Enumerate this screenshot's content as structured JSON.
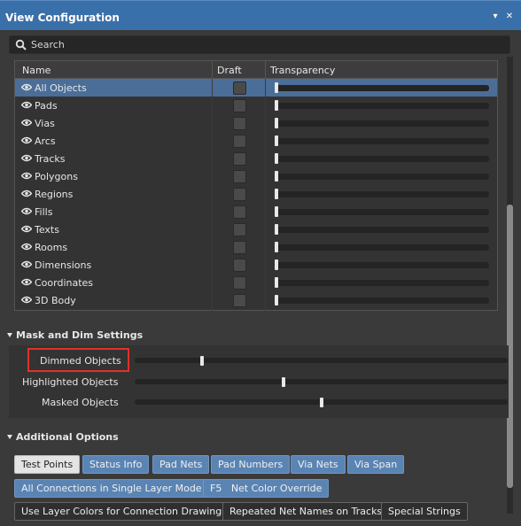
{
  "window": {
    "title": "View Configuration",
    "pin_glyph": "▾",
    "close_glyph": "✕"
  },
  "search": {
    "placeholder": "Search",
    "icon": "search-icon"
  },
  "objects": {
    "columns": {
      "name": "Name",
      "draft": "Draft",
      "transparency": "Transparency"
    },
    "rows": [
      {
        "label": "All Objects",
        "selected": true,
        "draft": false,
        "transparency": 0
      },
      {
        "label": "Pads",
        "draft": false,
        "transparency": 0
      },
      {
        "label": "Vias",
        "draft": false,
        "transparency": 0
      },
      {
        "label": "Arcs",
        "draft": false,
        "transparency": 0
      },
      {
        "label": "Tracks",
        "draft": false,
        "transparency": 0
      },
      {
        "label": "Polygons",
        "draft": false,
        "transparency": 0
      },
      {
        "label": "Regions",
        "draft": false,
        "transparency": 0
      },
      {
        "label": "Fills",
        "draft": false,
        "transparency": 0
      },
      {
        "label": "Texts",
        "draft": false,
        "transparency": 0
      },
      {
        "label": "Rooms",
        "draft": false,
        "transparency": 0
      },
      {
        "label": "Dimensions",
        "draft": false,
        "transparency": 0
      },
      {
        "label": "Coordinates",
        "draft": false,
        "transparency": 0
      },
      {
        "label": "3D Body",
        "draft": false,
        "transparency": 0
      }
    ]
  },
  "mask_dim": {
    "title": "Mask and Dim Settings",
    "dimmed": {
      "label": "Dimmed Objects",
      "value": 0.18
    },
    "highlighted": {
      "label": "Highlighted Objects",
      "value": 0.4
    },
    "masked": {
      "label": "Masked Objects",
      "value": 0.5
    }
  },
  "additional": {
    "title": "Additional Options",
    "test_points": "Test Points",
    "status_info": "Status Info",
    "pad_nets": "Pad Nets",
    "pad_numbers": "Pad Numbers",
    "via_nets": "Via Nets",
    "via_span": "Via Span",
    "all_connections": "All Connections in Single Layer Mode",
    "net_color_override": "F5   Net Color Override",
    "use_layer_colors": "Use Layer Colors for Connection Drawing",
    "repeated_net_names": "Repeated Net Names on Tracks",
    "special_strings": "Special Strings"
  },
  "colors": {
    "accent": "#3a70a9",
    "selected_row": "#4b6e98",
    "toggle_on": "#5a84b4",
    "highlight": "#e0312a"
  }
}
